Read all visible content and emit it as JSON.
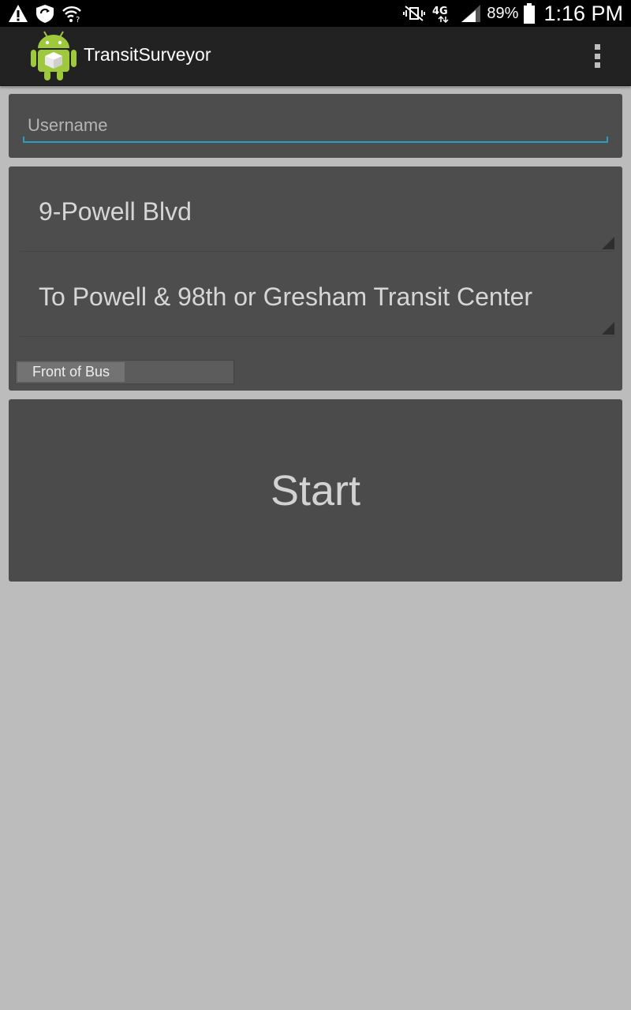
{
  "status_bar": {
    "left_icons": [
      "warning-icon",
      "shield-refresh-icon",
      "wifi-question-icon"
    ],
    "right_icons": [
      "mute-vibrate-icon",
      "network-4g-icon",
      "signal-icon",
      "battery-icon"
    ],
    "battery_percent": "89%",
    "time": "1:16 PM"
  },
  "action_bar": {
    "title": "TransitSurveyor",
    "icon": "android-app-icon",
    "overflow_icon": "overflow-menu-icon"
  },
  "login": {
    "username_placeholder": "Username",
    "username_value": ""
  },
  "route": {
    "line": "9-Powell Blvd",
    "direction": "To Powell & 98th or Gresham Transit Center",
    "bus_position_toggle": "Front of Bus"
  },
  "start_button": {
    "label": "Start"
  },
  "colors": {
    "accent": "#2a9ec0",
    "card": "#4d4d4d",
    "background": "#bcbcbc",
    "actionbar": "#222222"
  }
}
